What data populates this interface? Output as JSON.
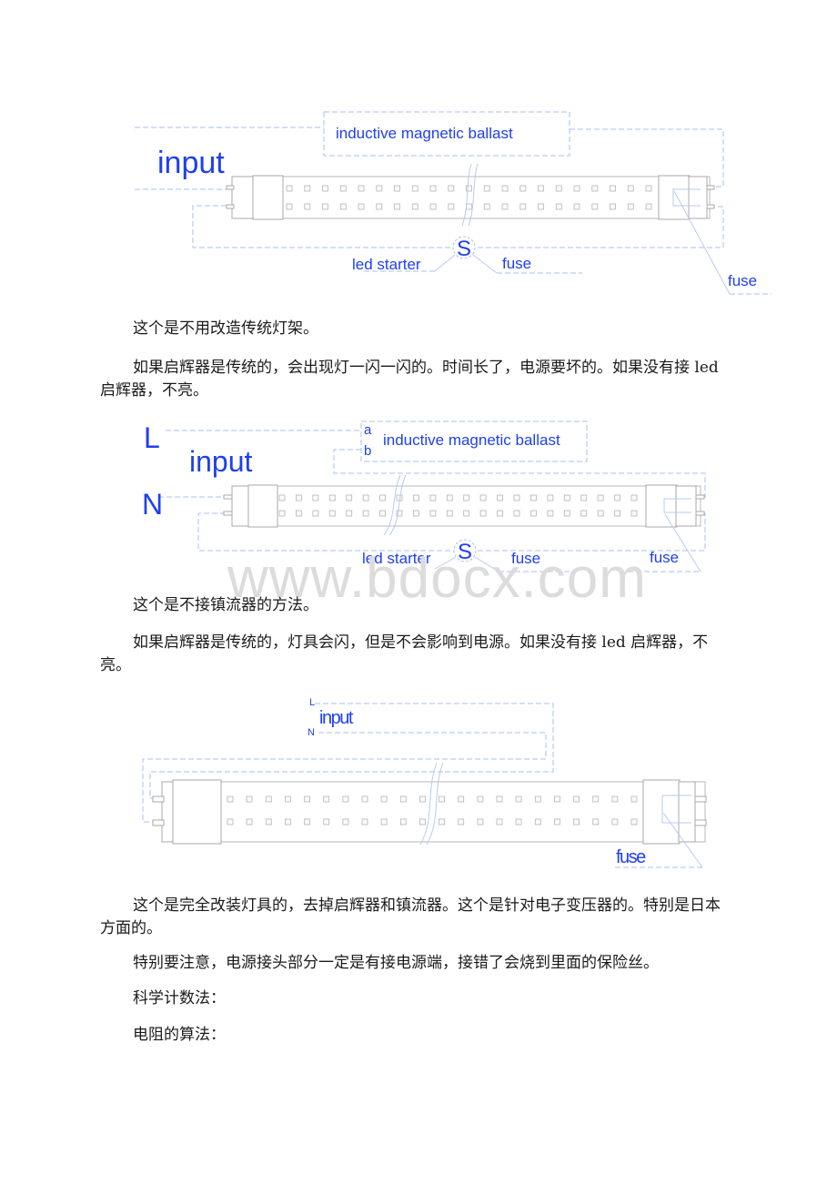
{
  "diagram1": {
    "input_label": "input",
    "ballast_label": "inductive magnetic ballast",
    "starter_symbol": "S",
    "starter_label": "led starter",
    "fuse_label_center": "fuse",
    "fuse_label_right": "fuse"
  },
  "paragraphs1": [
    "这个是不用改造传统灯架。",
    "如果启辉器是传统的，会出现灯一闪一闪的。时间长了，电源要坏的。如果没有接 led 启辉器，不亮。"
  ],
  "diagram2": {
    "line_label": "L",
    "neutral_label": "N",
    "input_label": "input",
    "terminal_a": "a",
    "terminal_b": "b",
    "ballast_label": "inductive magnetic ballast",
    "starter_symbol": "S",
    "starter_label": "led starter",
    "fuse_label_center": "fuse",
    "fuse_label_right": "fuse"
  },
  "watermark": "www.bdocx.com",
  "paragraphs2": [
    "这个是不接镇流器的方法。",
    "如果启辉器是传统的，灯具会闪，但是不会影响到电源。如果没有接 led 启辉器，不亮。"
  ],
  "diagram3": {
    "line_label": "L",
    "neutral_label": "N",
    "input_label": "input",
    "fuse_label": "fuse"
  },
  "paragraphs3": [
    "这个是完全改装灯具的，去掉启辉器和镇流器。这个是针对电子变压器的。特别是日本方面的。",
    "特别要注意，电源接头部分一定是有接电源端，接错了会烧到里面的保险丝。",
    "科学计数法：",
    "电阻的算法："
  ],
  "colors": {
    "label_blue": "#1f3ff0",
    "wire_blue": "#a9bff0",
    "tube_gray": "#b8b8b8"
  }
}
